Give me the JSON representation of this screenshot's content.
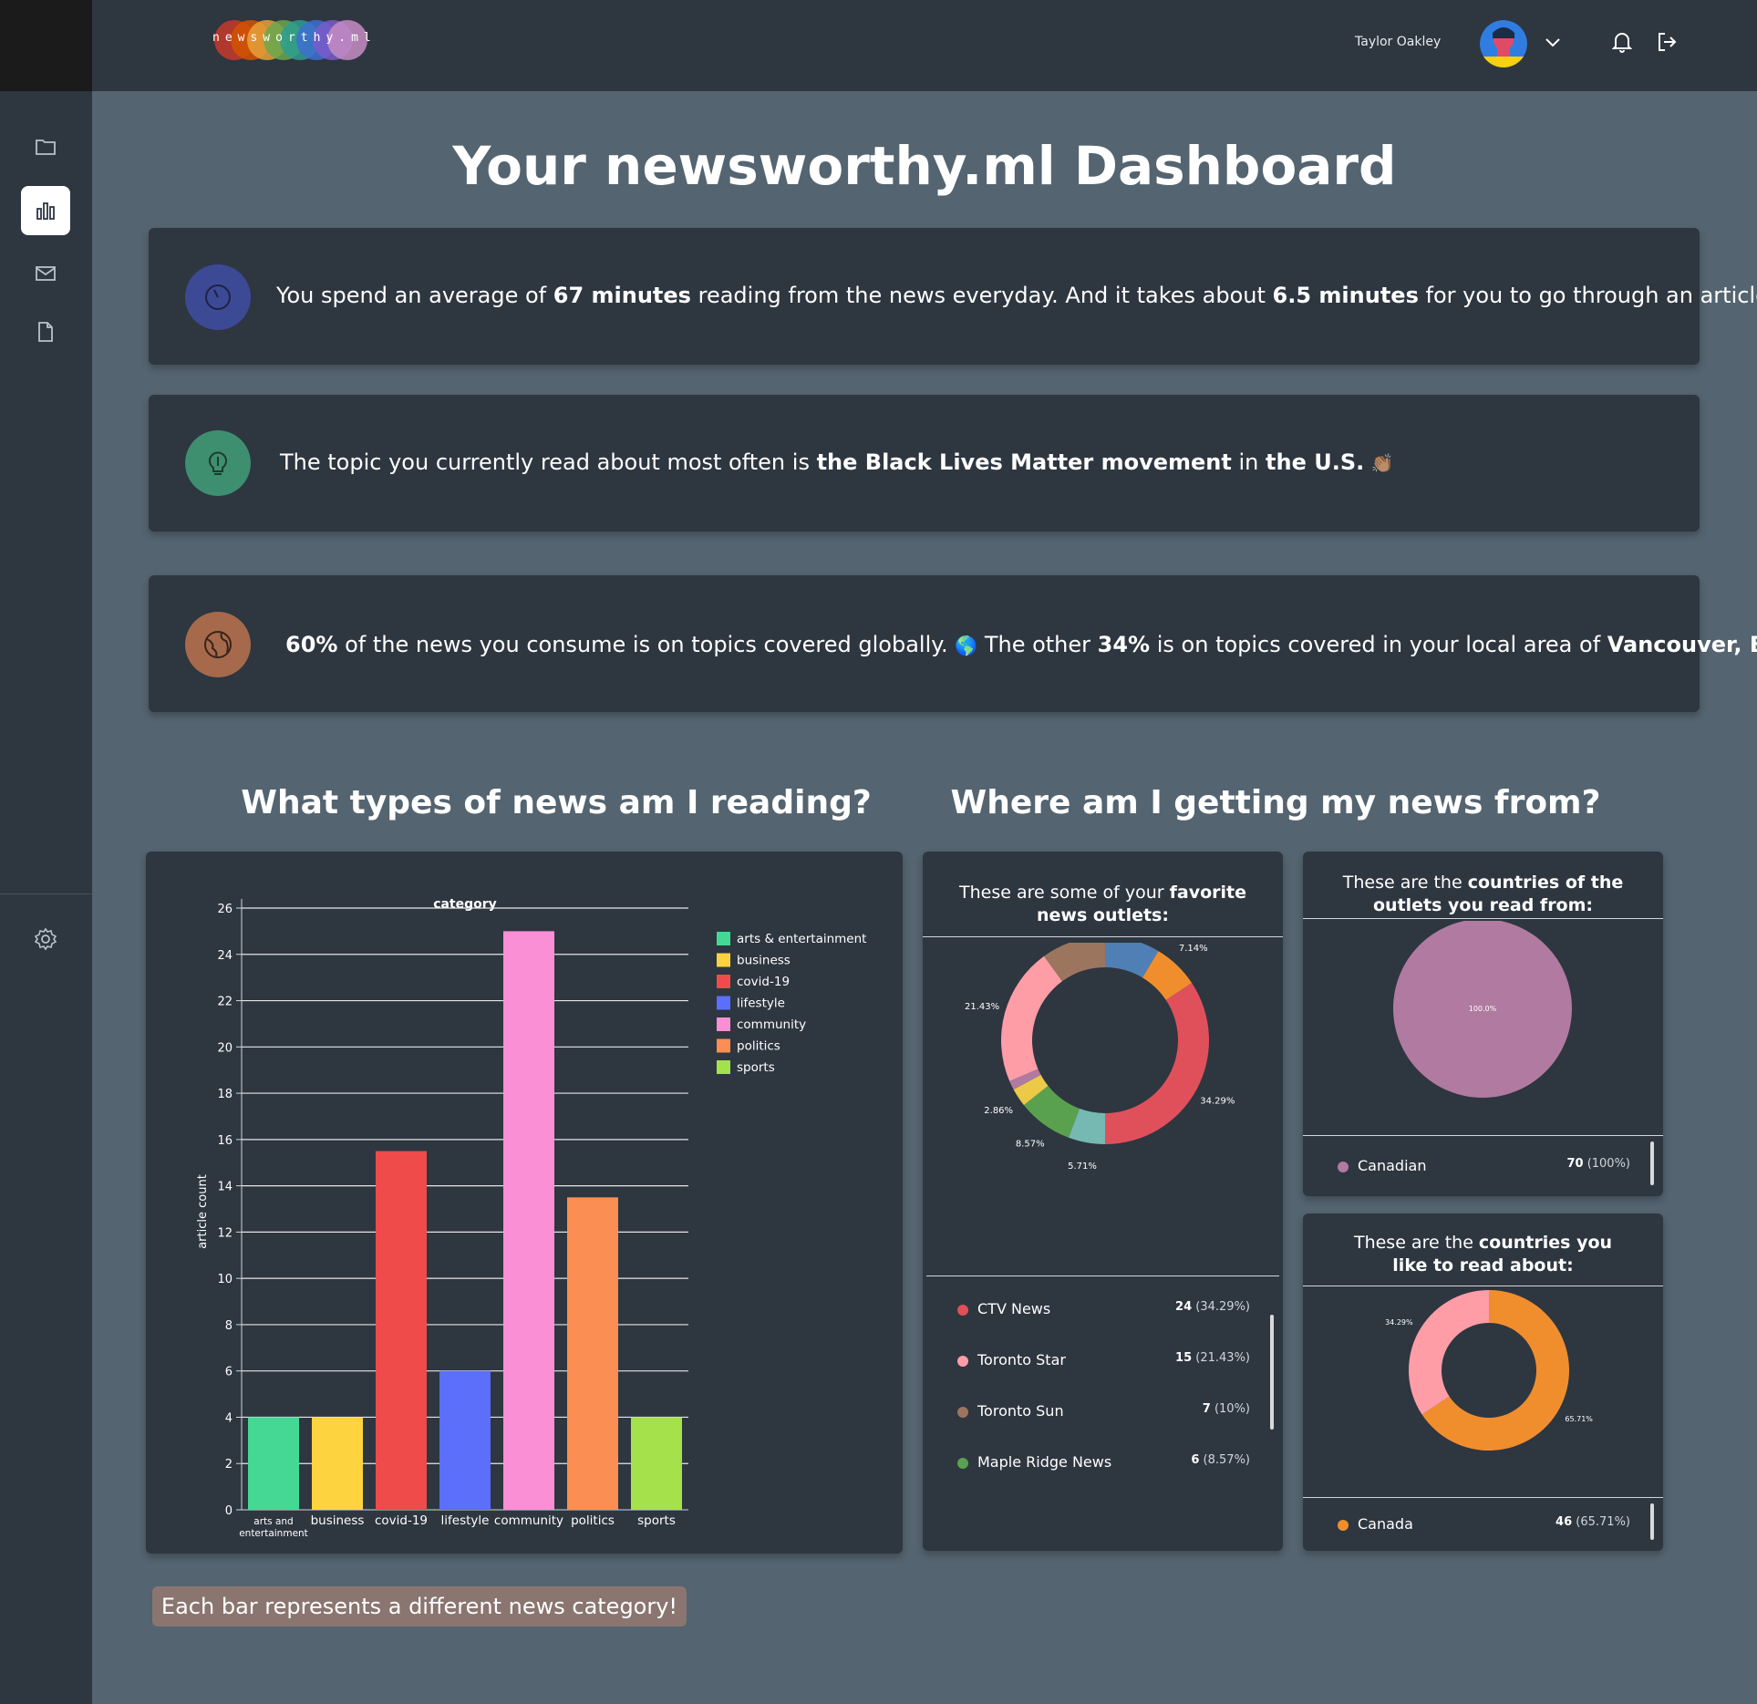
{
  "app": {
    "logo_text": "newsworthy.ml",
    "user_name": "Taylor Oakley"
  },
  "sidebar": {
    "items": [
      {
        "icon": "folder-icon"
      },
      {
        "icon": "bar-chart-icon",
        "active": true
      },
      {
        "icon": "mail-icon"
      },
      {
        "icon": "document-icon"
      },
      {
        "icon": "settings-icon"
      }
    ]
  },
  "header": {
    "icons": [
      "chevron-down-icon",
      "bell-icon",
      "logout-icon"
    ]
  },
  "page": {
    "title": "Your newsworthy.ml Dashboard"
  },
  "stats": {
    "reading_time": {
      "icon": "clock-icon",
      "t1": "You spend an average of ",
      "b1": "67 minutes",
      "t2": " reading from the news everyday. And it takes about ",
      "b2": "6.5 minutes",
      "t3": " for you to go through an article! ",
      "emoji": "😯"
    },
    "topic": {
      "icon": "lightbulb-icon",
      "t1": "The topic you currently read about most often is ",
      "b1": "the Black Lives Matter movement",
      "t2": " in ",
      "b2": "the U.S.",
      "emoji": "👏🏽"
    },
    "coverage": {
      "icon": "globe-icon",
      "b1": "60%",
      "t1": " of the news you consume is on topics covered globally. ",
      "emoji1": "🌎",
      "t2": " The other ",
      "b2": "34%",
      "t3": " is on topics covered in your local area of ",
      "b3": "Vancouver, B.C.",
      "emoji2": "🇨🇦"
    }
  },
  "sections": {
    "types_title": "What types of news am I reading?",
    "sources_title": "Where am I getting my news from?"
  },
  "caption": "Each bar represents a different news category!",
  "chart_data": [
    {
      "type": "bar",
      "title": "category",
      "xlabel": "",
      "ylabel": "article count",
      "ylim": [
        0,
        26
      ],
      "yticks": [
        0,
        2,
        4,
        6,
        8,
        10,
        12,
        14,
        16,
        18,
        20,
        22,
        24,
        26
      ],
      "grid": true,
      "legend_position": "right",
      "categories": [
        "arts and entertainment",
        "business",
        "covid-19",
        "lifestyle",
        "community",
        "politics",
        "sports"
      ],
      "values": [
        4,
        4,
        15.5,
        6,
        25,
        13.5,
        4
      ],
      "colors": [
        "#45d894",
        "#fdd43f",
        "#ef4b4b",
        "#5c6ffb",
        "#fb8fd6",
        "#fb8e52",
        "#a4e14b"
      ],
      "legend": [
        "arts & entertainment",
        "business",
        "covid-19",
        "lifestyle",
        "community",
        "politics",
        "sports"
      ]
    },
    {
      "type": "pie",
      "title": "These are some of your favorite news outlets:",
      "slices": [
        {
          "value": 8.57,
          "label": "8.57%",
          "color": "#4f7fb4"
        },
        {
          "value": 7.14,
          "label": "7.14%",
          "color": "#f08e2e"
        },
        {
          "value": 34.29,
          "label": "34.29%",
          "color": "#e0505b"
        },
        {
          "value": 5.71,
          "label": "5.71%",
          "color": "#76b8b2"
        },
        {
          "value": 8.57,
          "label": "8.57%",
          "color": "#59a14f"
        },
        {
          "value": 2.86,
          "label": "2.86%",
          "color": "#edc948"
        },
        {
          "value": 1.43,
          "label": "",
          "color": "#b07aa1"
        },
        {
          "value": 21.43,
          "label": "21.43%",
          "color": "#ff9da7"
        },
        {
          "value": 10.0,
          "label": "10.00%",
          "color": "#9c755f"
        }
      ]
    },
    {
      "type": "pie",
      "title": "These are the countries of the outlets you read from:",
      "slices": [
        {
          "value": 100,
          "label": "100.0%",
          "color": "#b07aa1"
        }
      ]
    },
    {
      "type": "pie",
      "title": "These are the countries you like to read about:",
      "slices": [
        {
          "value": 65.71,
          "label": "65.71%",
          "color": "#f08e2e"
        },
        {
          "value": 34.29,
          "label": "34.29%",
          "color": "#ff9da7"
        }
      ]
    }
  ],
  "outlets": {
    "title_pre": "These are some of your ",
    "title_bold": "favorite",
    "title_post": "news outlets:",
    "rows": [
      {
        "name": "CTV News",
        "count": "24",
        "pct": "(34.29%)",
        "color": "#e0505b"
      },
      {
        "name": "Toronto Star",
        "count": "15",
        "pct": "(21.43%)",
        "color": "#ff9da7"
      },
      {
        "name": "Toronto Sun",
        "count": "7",
        "pct": "(10%)",
        "color": "#9c755f"
      },
      {
        "name": "Maple Ridge News",
        "count": "6",
        "pct": "(8.57%)",
        "color": "#59a14f"
      }
    ]
  },
  "countries_from": {
    "title_pre": "These are the ",
    "title_bold": "countries of the",
    "title_bold2": "outlets you read from:",
    "rows": [
      {
        "name": "Canadian",
        "count": "70",
        "pct": "(100%)",
        "color": "#b07aa1"
      }
    ]
  },
  "countries_about": {
    "title_pre": "These are the ",
    "title_bold": "countries you",
    "title_bold2": "like to read about:",
    "rows": [
      {
        "name": "Canada",
        "count": "46",
        "pct": "(65.71%)",
        "color": "#f08e2e"
      }
    ]
  }
}
